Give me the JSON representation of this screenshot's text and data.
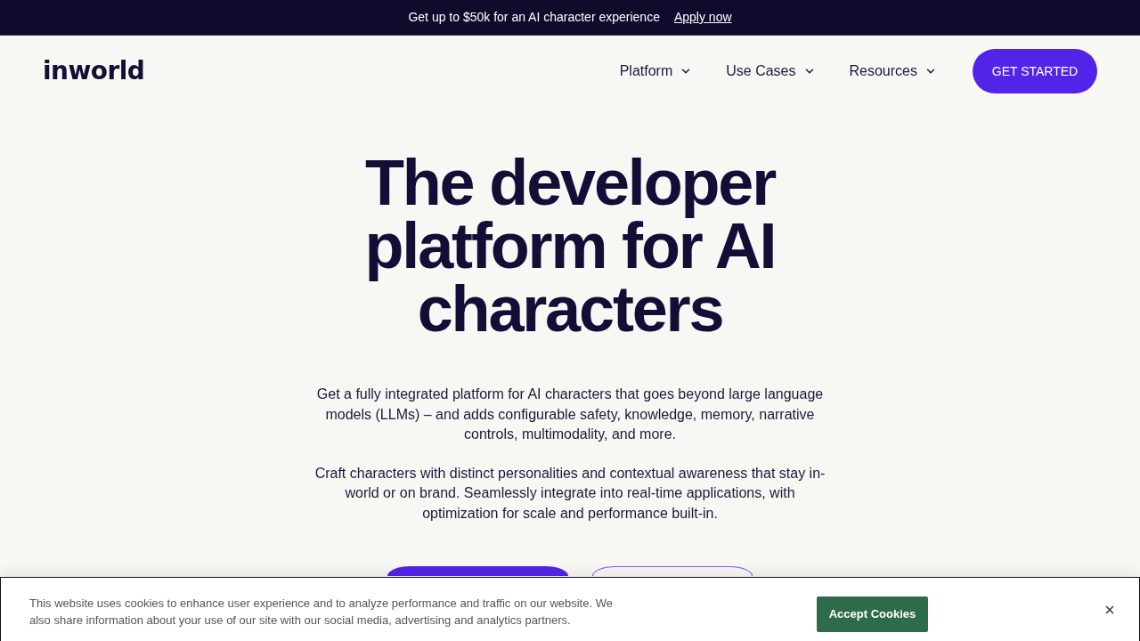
{
  "announcement": {
    "text": "Get up to $50k for an AI character experience",
    "link": "Apply now"
  },
  "nav": {
    "logo": "inworld",
    "items": [
      {
        "label": "Platform"
      },
      {
        "label": "Use Cases"
      },
      {
        "label": "Resources"
      }
    ],
    "cta": "GET STARTED"
  },
  "hero": {
    "title": "The developer platform for AI characters",
    "paragraphs": [
      "Get a fully integrated platform for AI characters that goes beyond large language models (LLMs) – and adds configurable safety, knowledge, memory, narrative controls, multimodality, and more.",
      "Craft characters with distinct personalities and contextual awareness that stay in-world or on brand. Seamlessly integrate into real-time applications, with optimization for scale and performance built-in."
    ],
    "buttons": [
      {
        "kind": "filled"
      },
      {
        "kind": "outline"
      }
    ]
  },
  "cookie_banner": {
    "text": "This website uses cookies to enhance user experience and to analyze performance and traffic on our website. We also share information about your use of our site with our social media, advertising and analytics partners.",
    "accept_button": "Accept Cookies"
  }
}
